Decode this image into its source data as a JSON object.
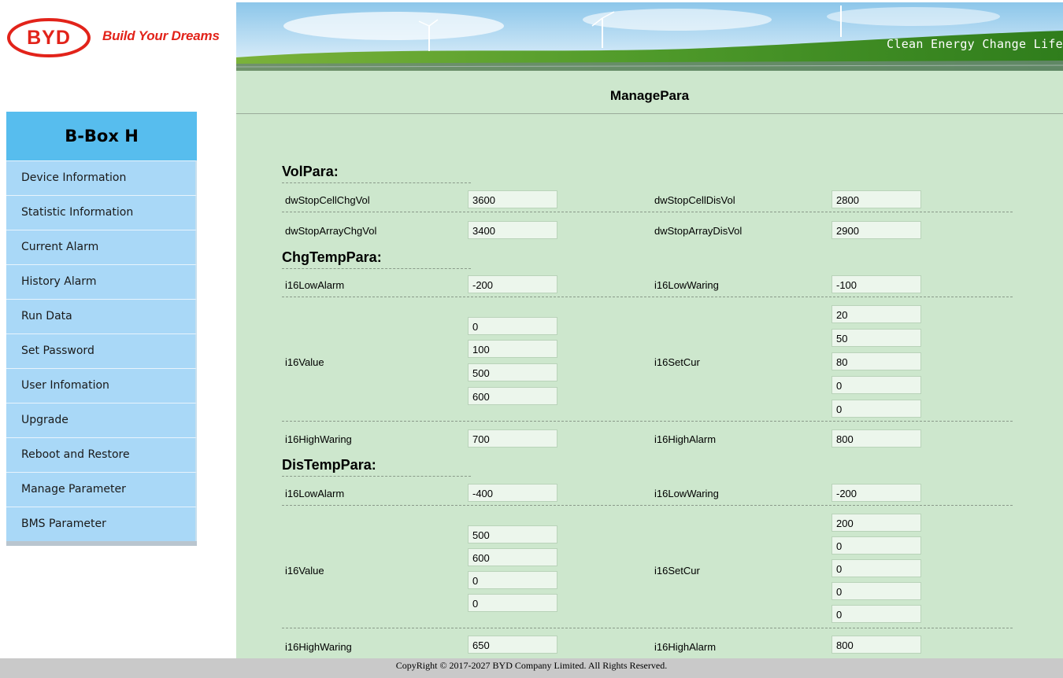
{
  "header": {
    "tagline": "Build Your Dreams",
    "slogan": "Clean Energy Change Life"
  },
  "sidebar": {
    "title": "B-Box H",
    "items": [
      {
        "label": "Device Information"
      },
      {
        "label": "Statistic Information"
      },
      {
        "label": "Current Alarm"
      },
      {
        "label": "History Alarm"
      },
      {
        "label": "Run Data"
      },
      {
        "label": "Set Password"
      },
      {
        "label": "User Infomation"
      },
      {
        "label": "Upgrade"
      },
      {
        "label": "Reboot and Restore"
      },
      {
        "label": "Manage Parameter"
      },
      {
        "label": "BMS Parameter"
      }
    ]
  },
  "main": {
    "title": "ManagePara",
    "vol": {
      "title": "VolPara:",
      "stop_cell_chg_label": "dwStopCellChgVol",
      "stop_cell_chg": "3600",
      "stop_cell_dis_label": "dwStopCellDisVol",
      "stop_cell_dis": "2800",
      "stop_array_chg_label": "dwStopArrayChgVol",
      "stop_array_chg": "3400",
      "stop_array_dis_label": "dwStopArrayDisVol",
      "stop_array_dis": "2900"
    },
    "chg": {
      "title": "ChgTempPara:",
      "low_alarm_label": "i16LowAlarm",
      "low_alarm": "-200",
      "low_waring_label": "i16LowWaring",
      "low_waring": "-100",
      "value_label": "i16Value",
      "values": [
        "0",
        "100",
        "500",
        "600"
      ],
      "setcur_label": "i16SetCur",
      "setcur": [
        "20",
        "50",
        "80",
        "0",
        "0"
      ],
      "high_waring_label": "i16HighWaring",
      "high_waring": "700",
      "high_alarm_label": "i16HighAlarm",
      "high_alarm": "800"
    },
    "dis": {
      "title": "DisTempPara:",
      "low_alarm_label": "i16LowAlarm",
      "low_alarm": "-400",
      "low_waring_label": "i16LowWaring",
      "low_waring": "-200",
      "value_label": "i16Value",
      "values": [
        "500",
        "600",
        "0",
        "0"
      ],
      "setcur_label": "i16SetCur",
      "setcur": [
        "200",
        "0",
        "0",
        "0",
        "0"
      ],
      "high_waring_label": "i16HighWaring",
      "high_waring": "650",
      "high_alarm_label": "i16HighAlarm",
      "high_alarm": "800"
    }
  },
  "footer": {
    "text": "CopyRight © 2017-2027 BYD Company Limited. All Rights Reserved."
  },
  "colors": {
    "brand_red": "#e2231a",
    "sidebar_title_bg": "#57bdee",
    "sidebar_item_bg": "#a9d8f7",
    "main_bg": "#cde7cd"
  }
}
